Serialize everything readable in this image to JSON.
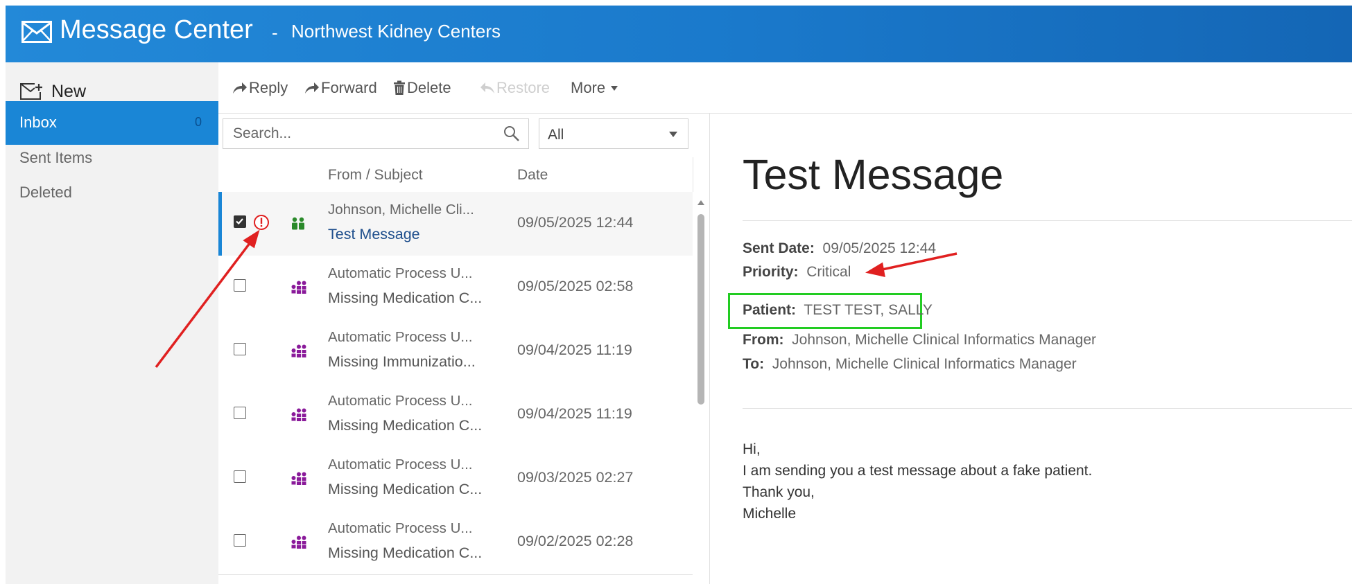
{
  "header": {
    "title": "Message Center",
    "separator": "-",
    "organization": "Northwest Kidney Centers",
    "icon": "envelope-icon",
    "background": "#1a79cb"
  },
  "sidebar": {
    "new_label": "New",
    "items": [
      {
        "label": "Inbox",
        "count": "0",
        "active": true
      },
      {
        "label": "Sent Items"
      },
      {
        "label": "Deleted"
      }
    ]
  },
  "toolbar": {
    "reply": "Reply",
    "forward": "Forward",
    "delete": "Delete",
    "restore": "Restore",
    "more": "More"
  },
  "list": {
    "search_placeholder": "Search...",
    "filter_value": "All",
    "columns": {
      "from_subject": "From / Subject",
      "date": "Date"
    },
    "rows": [
      {
        "from": "Johnson, Michelle Cli...",
        "subject": "Test Message",
        "date": "09/05/2025 12:44",
        "checked": true,
        "priority": "critical",
        "group_icon": "two-people-icon",
        "group_color": "#2a8a2a"
      },
      {
        "from": "Automatic Process U...",
        "subject": "Missing Medication C...",
        "date": "09/05/2025 02:58",
        "checked": false,
        "group_icon": "group-icon",
        "group_color": "#8a1a9a"
      },
      {
        "from": "Automatic Process U...",
        "subject": "Missing Immunizatio...",
        "date": "09/04/2025 11:19",
        "checked": false,
        "group_icon": "group-icon",
        "group_color": "#8a1a9a"
      },
      {
        "from": "Automatic Process U...",
        "subject": "Missing Medication C...",
        "date": "09/04/2025 11:19",
        "checked": false,
        "group_icon": "group-icon",
        "group_color": "#8a1a9a"
      },
      {
        "from": "Automatic Process U...",
        "subject": "Missing Medication C...",
        "date": "09/03/2025 02:27",
        "checked": false,
        "group_icon": "group-icon",
        "group_color": "#8a1a9a"
      },
      {
        "from": "Automatic Process U...",
        "subject": "Missing Medication C...",
        "date": "09/02/2025 02:28",
        "checked": false,
        "group_icon": "group-icon",
        "group_color": "#8a1a9a"
      }
    ]
  },
  "message": {
    "subject": "Test Message",
    "sent_date_label": "Sent Date:",
    "sent_date": "09/05/2025 12:44",
    "priority_label": "Priority:",
    "priority": "Critical",
    "patient_label": "Patient:",
    "patient": "TEST TEST, SALLY",
    "from_label": "From:",
    "from": "Johnson, Michelle Clinical Informatics Manager",
    "to_label": "To:",
    "to": "Johnson, Michelle Clinical Informatics Manager",
    "body": [
      "Hi,",
      "I am sending you a test message about a fake patient.",
      "Thank you,",
      "Michelle"
    ]
  },
  "annotations": {
    "arrow_color": "#e02020",
    "highlight_color": "#22cc22"
  }
}
